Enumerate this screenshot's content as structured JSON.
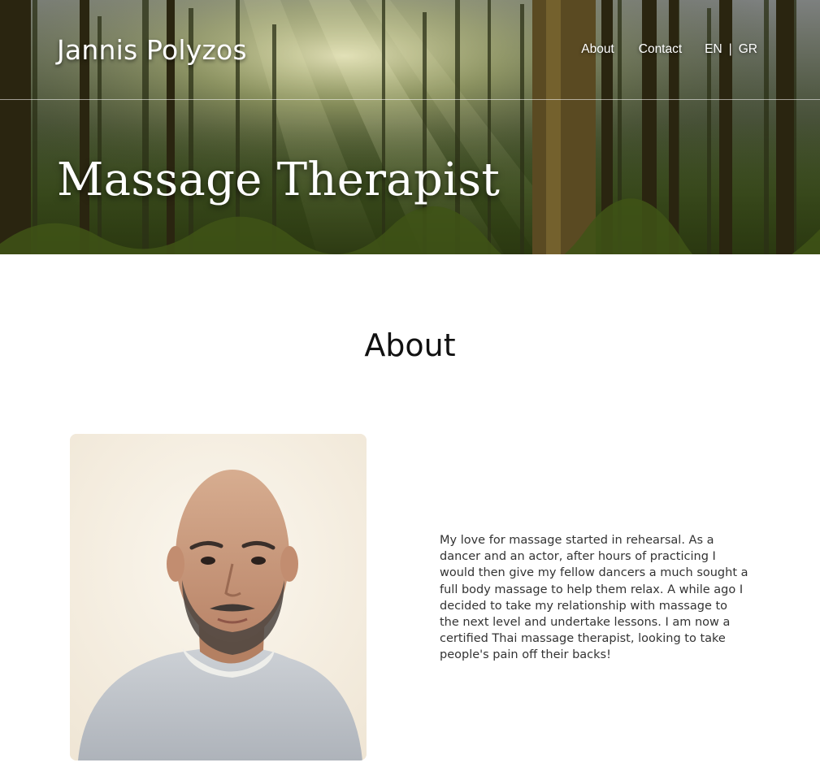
{
  "header": {
    "brand": "Jannis Polyzos",
    "nav": {
      "about": "About",
      "contact": "Contact",
      "lang_en": "EN",
      "lang_separator": "|",
      "lang_gr": "GR"
    },
    "hero_title": "Massage Therapist"
  },
  "about": {
    "title": "About",
    "bio": "My love for massage started in rehearsal. As a dancer and an actor, after hours of practicing I would then give my fellow dancers a much sought a full body massage to help them relax. A while ago I decided to take my relationship with massage to the next level and undertake lessons. I am now a certified Thai massage therapist, looking to take people's pain off their backs!"
  },
  "colors": {
    "hero_text": "#ffffff",
    "heading": "#111111",
    "body_text": "#333333"
  }
}
